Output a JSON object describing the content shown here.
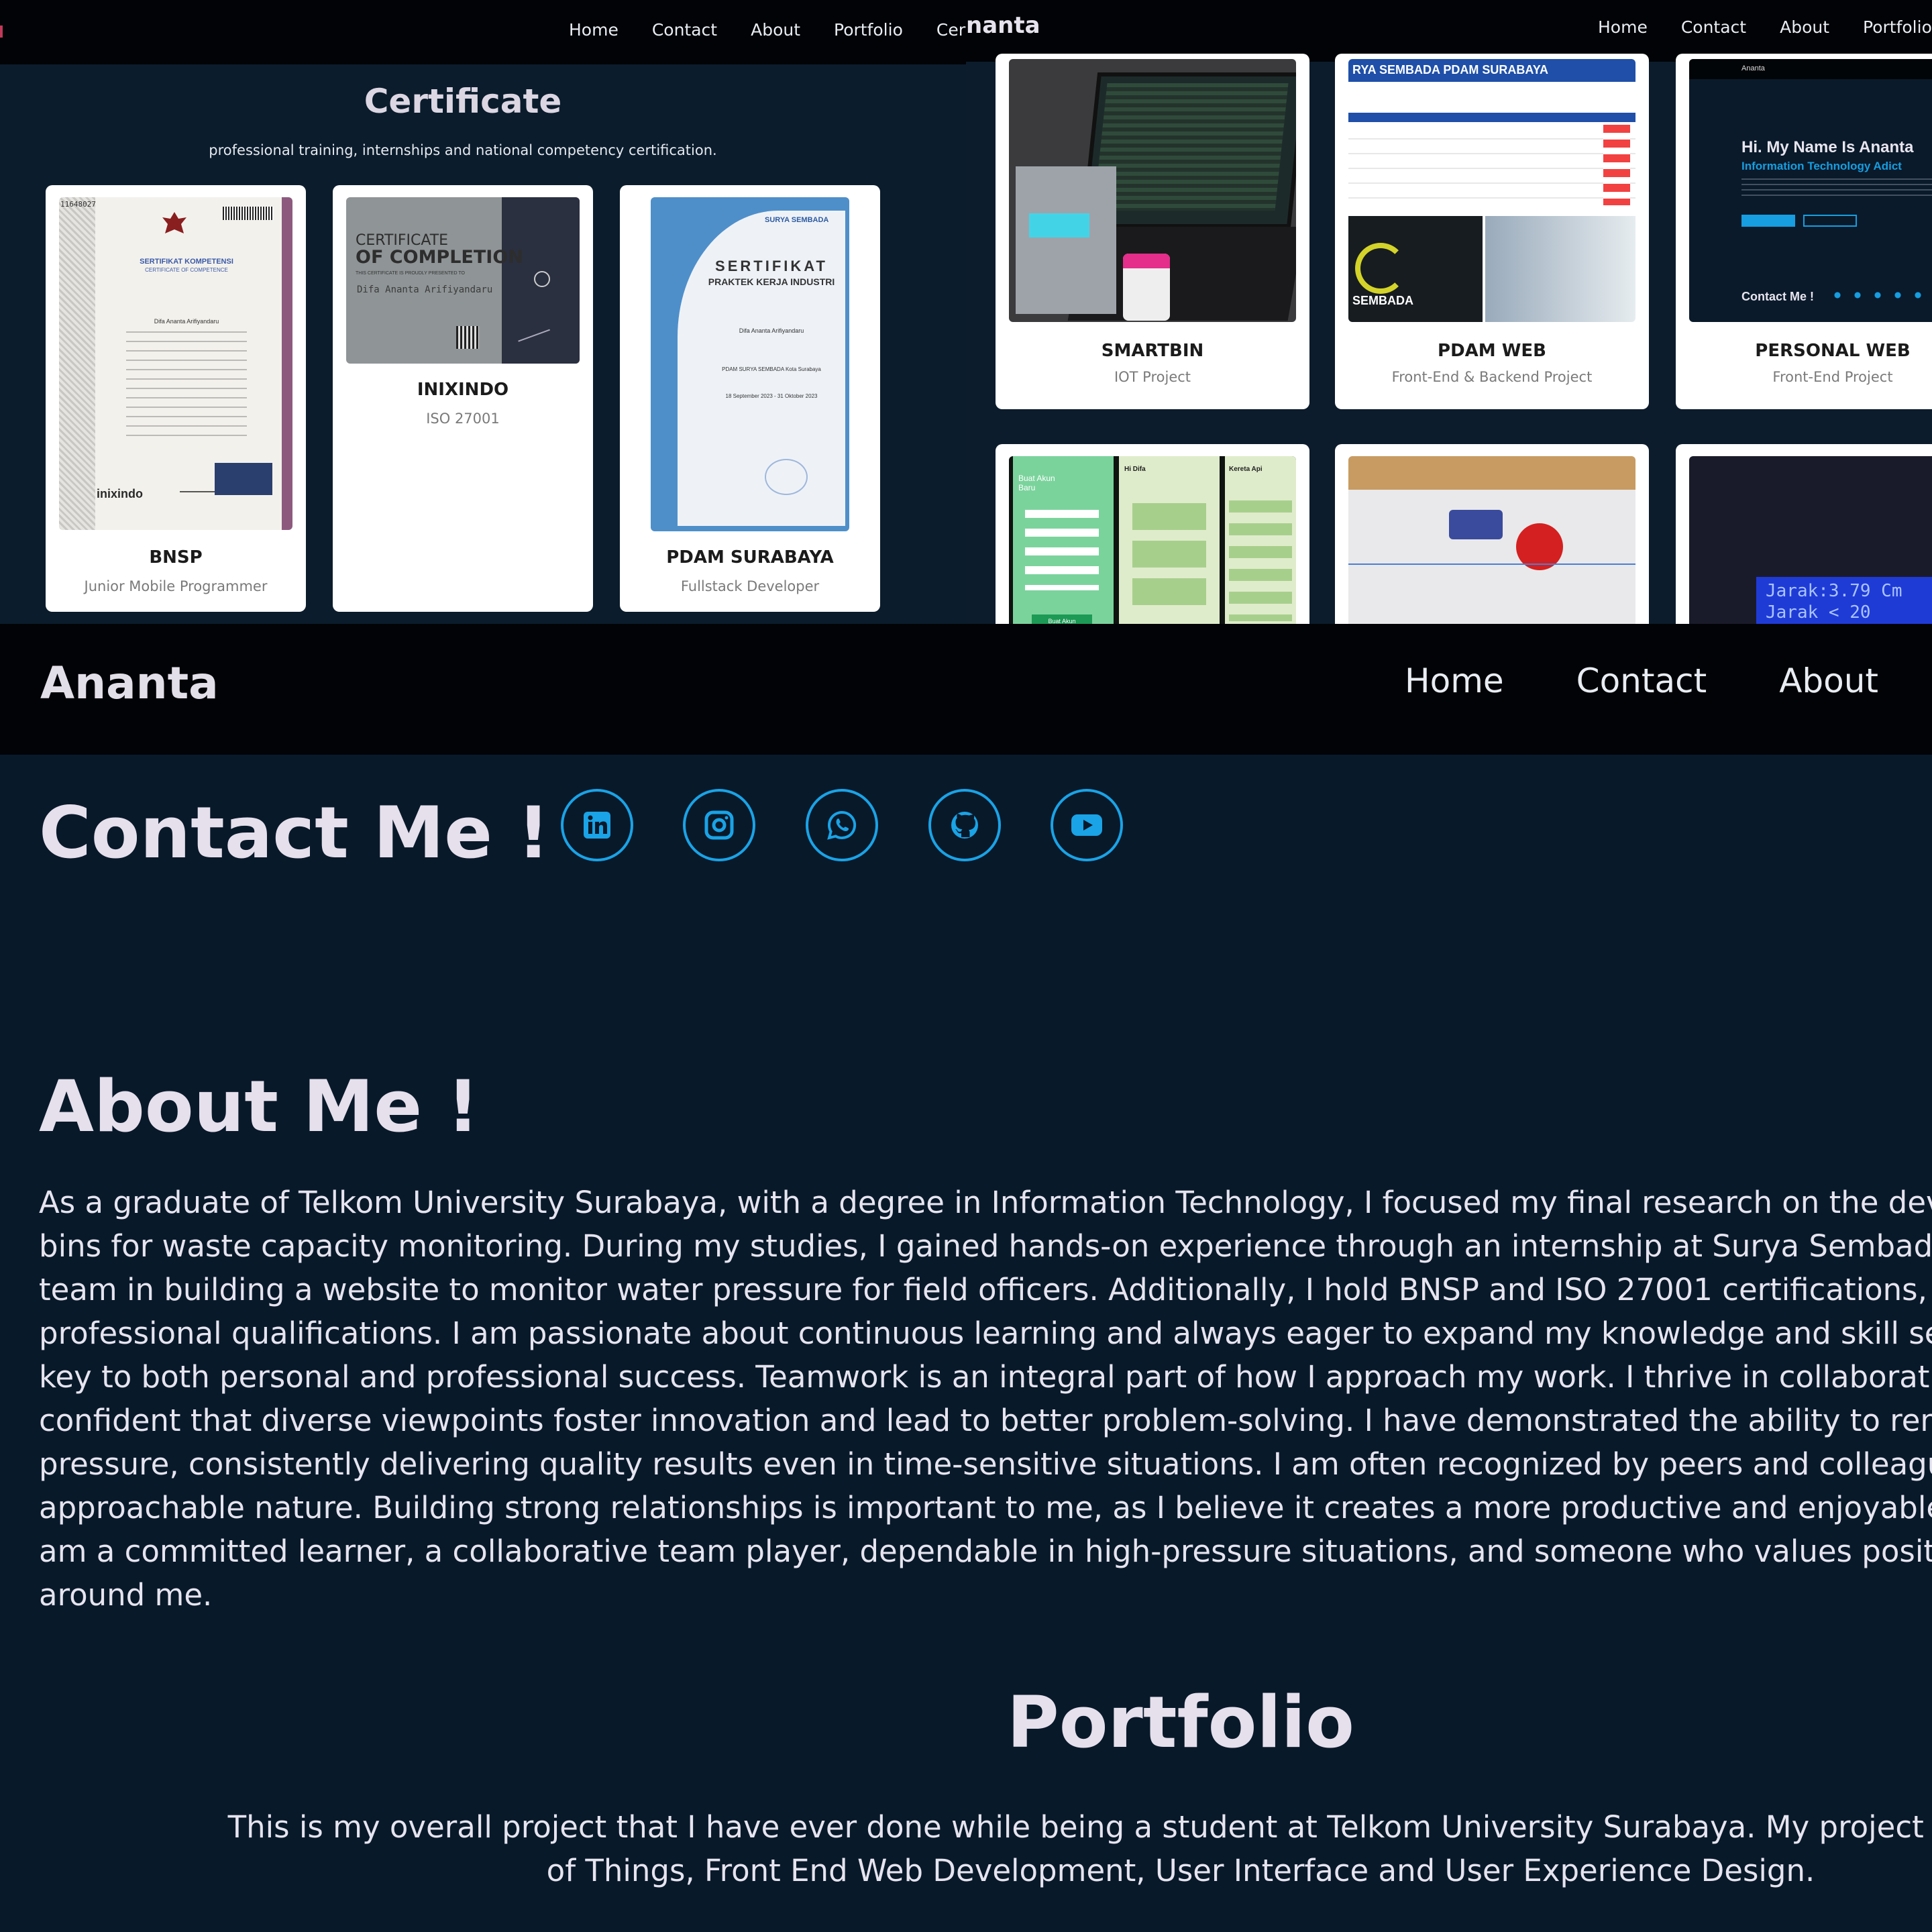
{
  "certificate_panel": {
    "nav": [
      "Home",
      "Contact",
      "About",
      "Portfolio",
      "Certif"
    ],
    "title": "Certificate",
    "subtitle": "professional training, internships and national competency certification.",
    "cards": [
      {
        "title": "BNSP",
        "subtitle": "Junior Mobile Programmer",
        "doc": {
          "number": "11648027",
          "heading": "SERTIFIKAT KOMPETENSI",
          "sub": "CERTIFICATE OF COMPETENCE",
          "name": "Difa Ananta Arifiyandaru",
          "logo": "inixindo"
        }
      },
      {
        "title": "INIXINDO",
        "subtitle": "ISO 27001",
        "doc": {
          "heading1": "CERTIFICATE",
          "heading2": "OF COMPLETION",
          "sub": "THIS CERTIFICATE IS PROUDLY PRESENTED TO",
          "name": "Difa Ananta Arifiyandaru"
        }
      },
      {
        "title": "PDAM SURABAYA",
        "subtitle": "Fullstack Developer",
        "doc": {
          "org": "SURYA SEMBADA",
          "heading": "SERTIFIKAT",
          "sub": "PRAKTEK KERJA INDUSTRI",
          "name": "Difa Ananta Arifiyandaru",
          "line": "PDAM SURYA SEMBADA Kota Surabaya",
          "dates": "18 September 2023 - 31 Oktober 2023"
        }
      }
    ]
  },
  "portfolio_panel": {
    "brand": "nanta",
    "nav": [
      "Home",
      "Contact",
      "About",
      "Portfolio"
    ],
    "cards": [
      {
        "title": "SMARTBIN",
        "subtitle": "IOT Project"
      },
      {
        "title": "PDAM WEB",
        "subtitle": "Front-End & Backend Project",
        "thumb_header": "RYA SEMBADA PDAM SURABAYA",
        "thumb_caption": "SEMBADA"
      },
      {
        "title": "PERSONAL WEB",
        "subtitle": "Front-End Project",
        "thumb": {
          "brand": "Ananta",
          "hello": "Hi. My Name Is Ananta",
          "tagline": "Information Technology Adict",
          "contact": "Contact Me !"
        }
      }
    ],
    "bottom_thumbs": {
      "app_title": "Buat Akun Baru",
      "app_button": "Buat Akun",
      "app_greeting": "Hi Difa",
      "app_section": "Kereta Api",
      "lcd_line1": "Jarak:3.79 Cm",
      "lcd_line2": "Jarak < 20"
    }
  },
  "main_panel": {
    "brand": "Ananta",
    "nav": [
      "Home",
      "Contact",
      "About"
    ],
    "contact_heading": "Contact Me !",
    "social_icons": [
      "linkedin-icon",
      "instagram-icon",
      "whatsapp-icon",
      "github-icon",
      "youtube-icon"
    ],
    "about_heading": "About Me !",
    "about_lines": [
      "As a graduate of Telkom University Surabaya, with a degree in Information Technology, I focused my final research on the developm",
      "bins for waste capacity monitoring. During my studies, I gained hands-on experience through an internship at Surya Sembada PDA",
      "team in building a website to monitor water pressure for field officers. Additionally, I hold BNSP and ISO 27001 certifications, along wit",
      "professional qualifications. I am passionate about continuous learning and always eager to expand my knowledge and skill set, as",
      "key to both personal and professional success. Teamwork is an integral part of how I approach my work. I thrive in collaborative env",
      "confident that diverse viewpoints foster innovation and lead to better problem-solving. I have demonstrated the ability to remain c",
      "pressure, consistently delivering quality results even in time-sensitive situations. I am often recognized by peers and colleagues for",
      "approachable nature. Building strong relationships is important to me, as I believe it creates a more productive and enjoyable work",
      "am a committed learner, a collaborative team player, dependable in high-pressure situations, and someone who values positive in",
      "around me."
    ],
    "portfolio_heading": "Portfolio",
    "portfolio_lines": [
      "This is my overall project that I have ever done while being a student at Telkom University Surabaya. My project field experier",
      "of Things, Front End Web Development, User Interface and User Experience Design."
    ]
  },
  "colors": {
    "background": "#08192a",
    "nav": "#010306",
    "accent": "#1aa3e6",
    "heading": "#e6e0ec"
  }
}
